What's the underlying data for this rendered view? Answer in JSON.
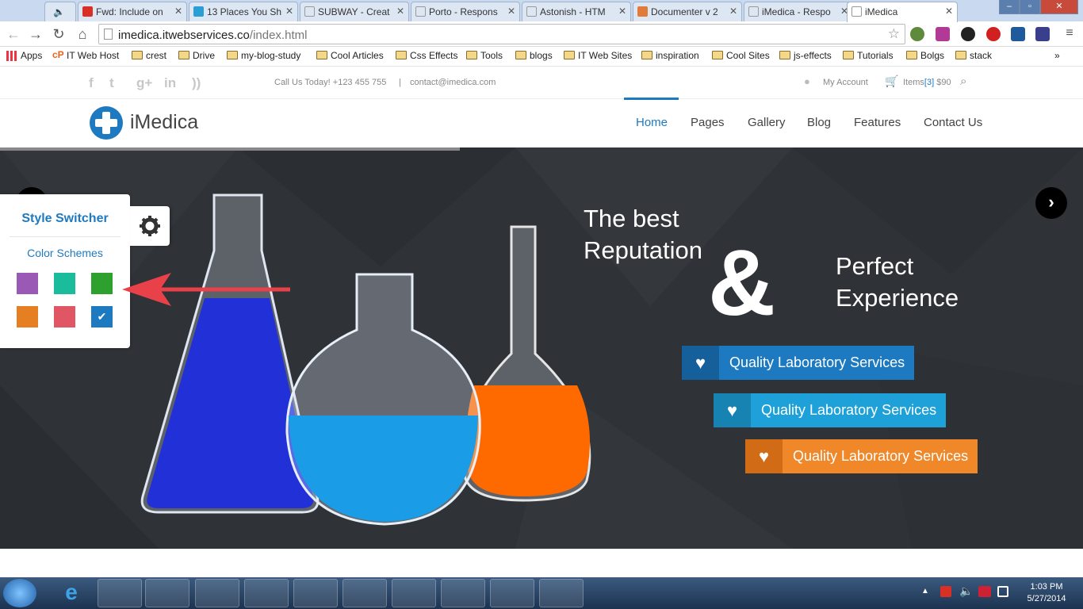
{
  "browser": {
    "tabs": [
      {
        "label": "Fwd: Include on",
        "icon_color": "#d93025"
      },
      {
        "label": "13 Places You Sh",
        "icon_color": "#2a9fd6"
      },
      {
        "label": "SUBWAY - Creat",
        "icon_color": "#ffffff"
      },
      {
        "label": "Porto - Respons",
        "icon_color": "#ffffff"
      },
      {
        "label": "Astonish - HTM",
        "icon_color": "#ffffff"
      },
      {
        "label": "Documenter v 2",
        "icon_color": "#e07b39"
      },
      {
        "label": "iMedica - Respo",
        "icon_color": "#ffffff"
      },
      {
        "label": "iMedica",
        "icon_color": "#ffffff",
        "active": true
      }
    ],
    "url_host": "imedica.itwebservices.co",
    "url_path": "/index.html",
    "bookmarks": [
      "Apps",
      "IT Web Host",
      "crest",
      "Drive",
      "my-blog-study",
      "Cool Articles",
      "Css Effects",
      "Tools",
      "blogs",
      "IT Web Sites",
      "inspiration",
      "Cool Sites",
      "js-effects",
      "Tutorials",
      "Bolgs",
      "stack"
    ],
    "bookmarks_more": "»"
  },
  "topbar": {
    "social_icons": [
      "facebook-icon",
      "twitter-icon",
      "google-plus-icon",
      "linkedin-icon",
      "rss-icon"
    ],
    "phone": "Call Us Today! +123 455 755",
    "separator": "|",
    "email": "contact@imedica.com",
    "account": "My Account",
    "cart_prefix": "Items",
    "cart_count": "[3]",
    "cart_total": "$90"
  },
  "header": {
    "logo": "iMedica",
    "nav": [
      "Home",
      "Pages",
      "Gallery",
      "Blog",
      "Features",
      "Contact Us"
    ],
    "active": "Home"
  },
  "hero": {
    "line1a": "The best",
    "line1b": "Reputation",
    "amp": "&",
    "line2a": "Perfect",
    "line2b": "Experience",
    "services": [
      {
        "label": "Quality Laboratory Services",
        "color": "#1e7ac0",
        "dark": "#15609a"
      },
      {
        "label": "Quality Laboratory Services",
        "color": "#1ea0d8",
        "dark": "#1683b3"
      },
      {
        "label": "Quality Laboratory Services",
        "color": "#f0882a",
        "dark": "#d26b15"
      }
    ],
    "next_glyph": "›"
  },
  "switcher": {
    "title": "Style Switcher",
    "subtitle": "Color Schemes",
    "swatches": [
      "#9b59b6",
      "#1abc9c",
      "#2da02d",
      "#e67e22",
      "#e05664",
      "#1e7ac0"
    ],
    "selected": 5,
    "check": "✔"
  },
  "taskbar": {
    "time": "1:03 PM",
    "date": "5/27/2014"
  }
}
